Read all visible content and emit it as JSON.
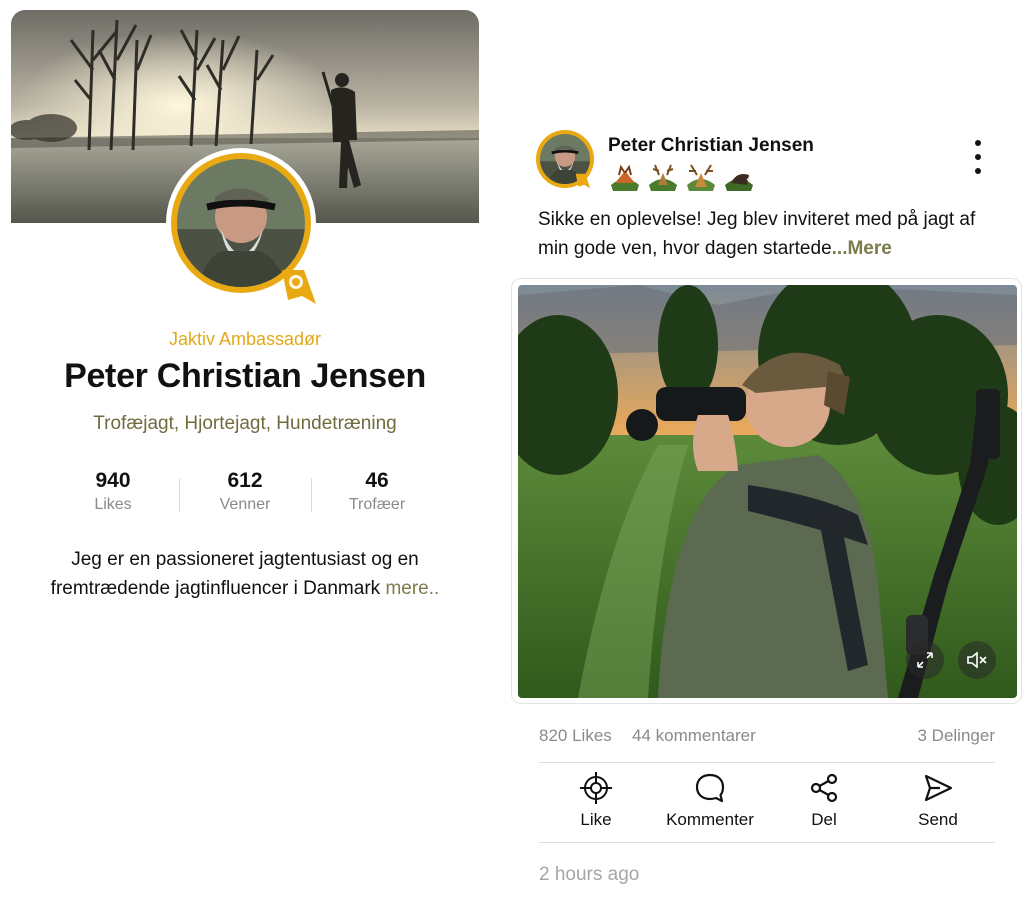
{
  "profile": {
    "role": "Jaktiv Ambassadør",
    "name": "Peter Christian Jensen",
    "interests": "Trofæjagt, Hjortejagt, Hundetræning",
    "stats": [
      {
        "value": "940",
        "label": "Likes"
      },
      {
        "value": "612",
        "label": "Venner"
      },
      {
        "value": "46",
        "label": "Trofæer"
      }
    ],
    "bio": "Jeg er en passioneret jagtentusiast og en fremtrædende jagtinfluencer i Danmark",
    "bio_more": "mere.."
  },
  "post": {
    "author": "Peter Christian Jensen",
    "badges": [
      "fox-badge",
      "deer-badge",
      "stag-badge",
      "boar-badge"
    ],
    "text": "Sikke en oplevelse! Jeg blev inviteret med på jagt af min gode ven, hvor dagen startede",
    "text_more": "...Mere",
    "likes": "820 Likes",
    "comments": "44 kommentarer",
    "shares": "3 Delinger",
    "actions": [
      {
        "label": "Like",
        "icon": "crosshair-icon"
      },
      {
        "label": "Kommenter",
        "icon": "comment-icon"
      },
      {
        "label": "Del",
        "icon": "share-icon"
      },
      {
        "label": "Send",
        "icon": "send-icon"
      }
    ],
    "timestamp": "2 hours ago"
  },
  "colors": {
    "accent_gold": "#e2a81a",
    "olive_text": "#6f6b3e",
    "muted_gray": "#8a8a8a"
  }
}
